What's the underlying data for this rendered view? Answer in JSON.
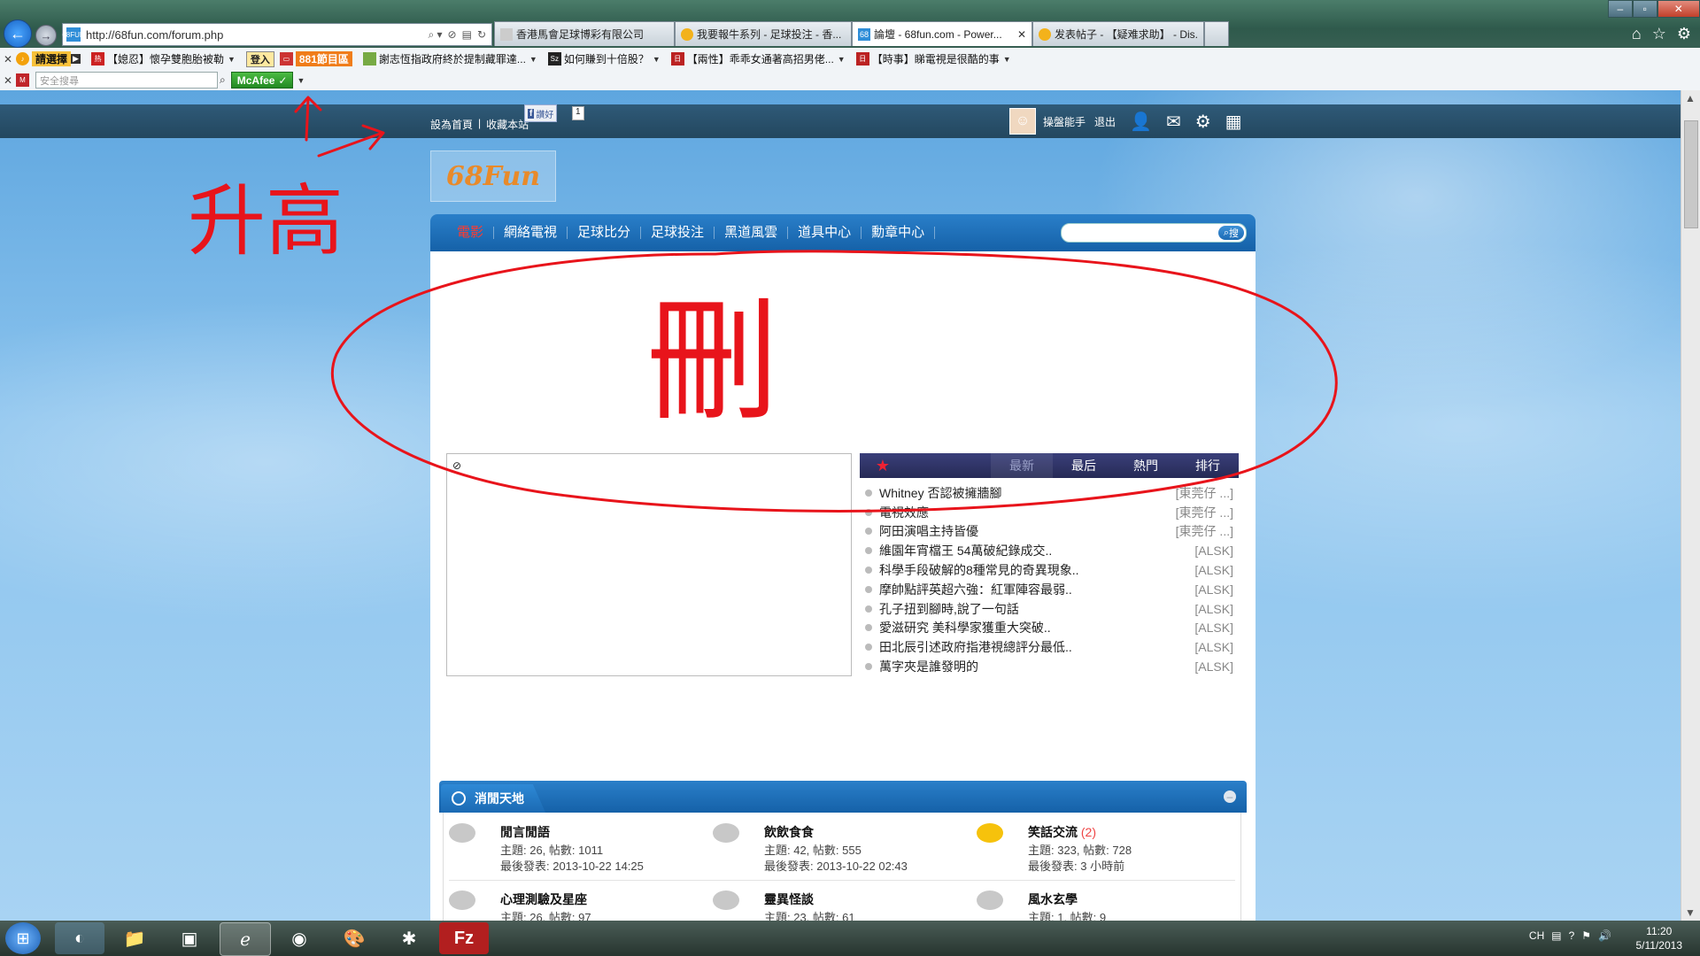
{
  "browser": {
    "url": "http://68fun.com/forum.php",
    "tabs": [
      {
        "title": "香港馬會足球博彩有限公司",
        "active": false
      },
      {
        "title": "我要報牛系列 - 足球投注 - 香...",
        "active": false
      },
      {
        "title": "論壇 - 68fun.com - Power...",
        "active": true
      },
      {
        "title": "发表帖子 - 【疑难求助】 - Dis...",
        "active": false
      }
    ],
    "favicon_text": "68FUN"
  },
  "toolbar1": {
    "brand_label": "請選擇",
    "ticker": "【媳忍】懷孕雙胞胎被勒",
    "login_label": "登入",
    "tv_label": "881節目區",
    "links": [
      "謝志恆指政府終於提制藏罪達...",
      "如何賺到十倍股？",
      "【兩性】乖乖女通著高招男佬...",
      "【時事】睇電視是很酷的事"
    ]
  },
  "toolbar2": {
    "search_placeholder": "安全搜尋",
    "mcafee_label": "McAfee"
  },
  "site": {
    "toplinks": [
      "設為首頁",
      "收藏本站"
    ],
    "like_label": "讚好",
    "like_count": "1",
    "username": "操盤能手",
    "logout": "退出",
    "logo_text": "68Fun",
    "nav": [
      {
        "label": "電影",
        "active": true
      },
      {
        "label": "網絡電視",
        "active": false
      },
      {
        "label": "足球比分",
        "active": false
      },
      {
        "label": "足球投注",
        "active": false
      },
      {
        "label": "黑道風雲",
        "active": false
      },
      {
        "label": "道具中心",
        "active": false
      },
      {
        "label": "勳章中心",
        "active": false
      }
    ],
    "search_button": "搜",
    "news_tabs": [
      "最新",
      "最后",
      "熱門",
      "排行"
    ],
    "news": [
      {
        "title": "Whitney 否認被擁牆腳",
        "author": "[東莞仔 ...]"
      },
      {
        "title": "電視效應",
        "author": "[東莞仔 ...]"
      },
      {
        "title": "阿田演唱主持皆優",
        "author": "[東莞仔 ...]"
      },
      {
        "title": "維園年宵檔王 54萬破紀錄成交..",
        "author": "[ALSK]"
      },
      {
        "title": "科學手段破解的8種常見的奇異現象..",
        "author": "[ALSK]"
      },
      {
        "title": "摩帥點評英超六強：紅軍陣容最弱..",
        "author": "[ALSK]"
      },
      {
        "title": "孔子扭到腳時,說了一句話",
        "author": "[ALSK]"
      },
      {
        "title": "愛滋研究 美科學家獲重大突破..",
        "author": "[ALSK]"
      },
      {
        "title": "田北辰引述政府指港視總評分最低..",
        "author": "[ALSK]"
      },
      {
        "title": "萬字夾是誰發明的",
        "author": "[ALSK]"
      }
    ],
    "section_title": "消閒天地",
    "forums": [
      {
        "name": "閒言閒語",
        "count": "",
        "stats": "主題: 26, 帖數: 1011",
        "last": "最後發表: 2013-10-22 14:25",
        "new": false
      },
      {
        "name": "飲飲食食",
        "count": "",
        "stats": "主題: 42, 帖數: 555",
        "last": "最後發表: 2013-10-22 02:43",
        "new": false
      },
      {
        "name": "笑話交流",
        "count": "(2)",
        "stats": "主題: 323, 帖數: 728",
        "last": "最後發表: 3 小時前",
        "new": true
      },
      {
        "name": "心理測驗及星座",
        "count": "",
        "stats": "主題: 26, 帖數: 97",
        "last": "",
        "new": false
      },
      {
        "name": "靈異怪談",
        "count": "",
        "stats": "主題: 23, 帖數: 61",
        "last": "",
        "new": false
      },
      {
        "name": "風水玄學",
        "count": "",
        "stats": "主題: 1, 帖數: 9",
        "last": "",
        "new": false
      }
    ]
  },
  "annotations": {
    "raise_text": "升高",
    "delete_text": "刪",
    "color": "#e8141b"
  },
  "taskbar": {
    "lang": "CH",
    "time": "11:20",
    "date": "5/11/2013"
  },
  "colors": {
    "nav_blue": "#1f72bd",
    "top_bar": "#23475f",
    "news_header": "#2d3266",
    "active_nav": "#ff3b30"
  }
}
